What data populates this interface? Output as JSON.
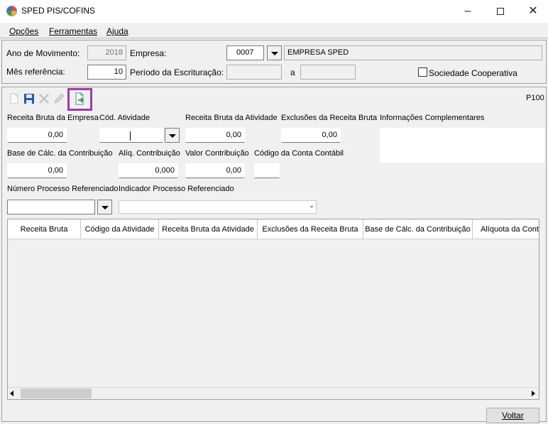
{
  "window": {
    "title": "SPED PIS/COFINS",
    "app_icon": "sped-app-icon"
  },
  "menu": {
    "items": [
      "Opções",
      "Ferramentas",
      "Ajuda"
    ]
  },
  "header": {
    "ano_label": "Ano de Movimento:",
    "ano_value": "2018",
    "empresa_label": "Empresa:",
    "empresa_code": "0007",
    "empresa_name": "EMPRESA SPED",
    "mes_label": "Mês referência:",
    "mes_value": "10",
    "periodo_label": "Período da Escrituração:",
    "periodo_from": "",
    "a_label": "a",
    "periodo_to": "",
    "sociedade_label": "Sociedade Cooperativa",
    "sociedade_checked": false
  },
  "toolbar": {
    "icons": [
      "new-icon",
      "save-icon",
      "delete-icon",
      "edit-icon",
      "export-icon"
    ],
    "highlight_color": "#9b3da6",
    "register_code": "P100"
  },
  "form": {
    "receita_bruta_empresa_label": "Receita Bruta da Empresa",
    "receita_bruta_empresa_value": "0,00",
    "cod_atividade_label": "Cód. Atividade",
    "cod_atividade_value": "",
    "receita_bruta_atividade_label": "Receita Bruta da Atividade",
    "receita_bruta_atividade_value": "0,00",
    "exclusoes_label": "Exclusões da Receita Bruta",
    "exclusoes_value": "0,00",
    "info_compl_label": "Informações Complementares",
    "info_compl_value": "",
    "base_calc_label": "Base de Cálc. da Contribuição",
    "base_calc_value": "0,00",
    "aliq_label": "Alíq. Contribuição",
    "aliq_value": "0,000",
    "valor_contrib_label": "Valor Contribuição",
    "valor_contrib_value": "0,00",
    "cod_conta_label": "Código da Conta Contábil",
    "cod_conta_value": "",
    "num_processo_label": "Número Processo Referenciado",
    "num_processo_value": "",
    "ind_processo_label": "Indicador Processo Referenciado",
    "ind_processo_value": ""
  },
  "grid": {
    "columns": [
      "Receita Bruta",
      "Código da Atividade",
      "Receita Bruta da Atividade",
      "Exclusões da Receita Bruta",
      "Base de Cálc. da Contribuição",
      "Alíquota da Contr"
    ],
    "rows": []
  },
  "footer": {
    "voltar_label": "Voltar"
  }
}
